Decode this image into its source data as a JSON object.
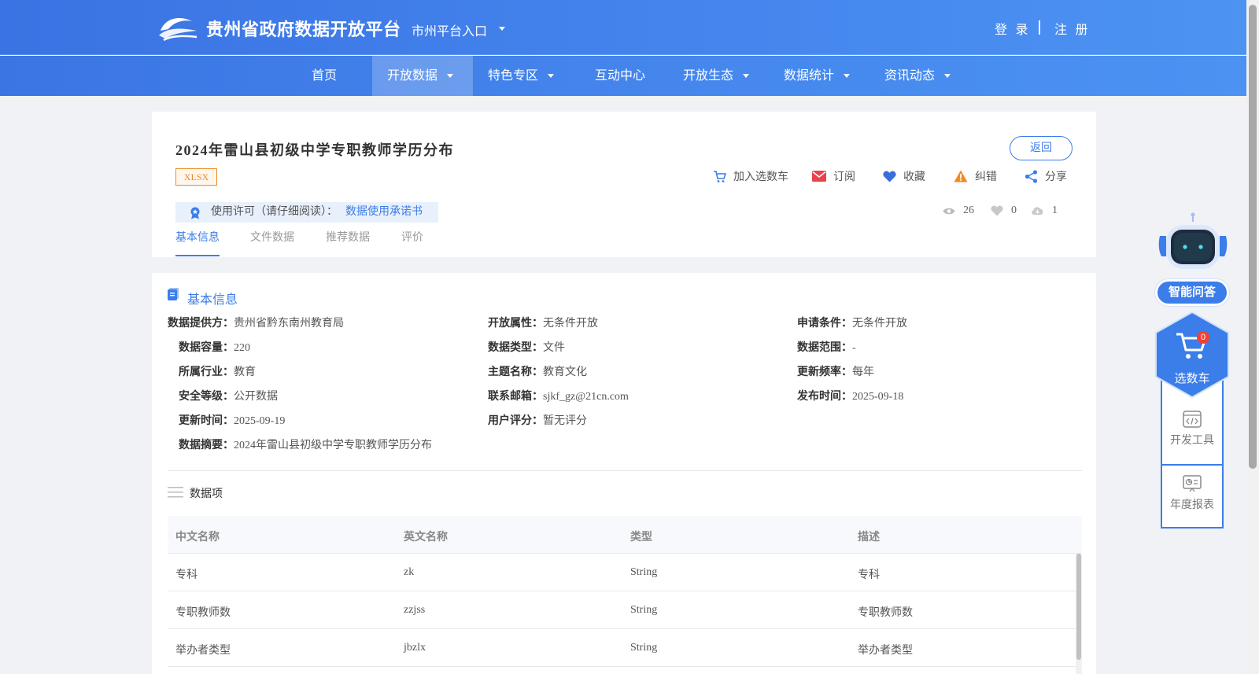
{
  "header": {
    "site_title": "贵州省政府数据开放平台",
    "city_entry": "市州平台入口",
    "login": "登 录",
    "register": "注 册"
  },
  "nav": {
    "items": [
      {
        "label": "首页"
      },
      {
        "label": "开放数据"
      },
      {
        "label": "特色专区"
      },
      {
        "label": "互动中心"
      },
      {
        "label": "开放生态"
      },
      {
        "label": "数据统计"
      },
      {
        "label": "资讯动态"
      }
    ],
    "active": "开放数据"
  },
  "dataset": {
    "title": "2024年雷山县初级中学专职教师学历分布",
    "format": "XLSX",
    "back": "返回",
    "actions": {
      "cart": "加入选数车",
      "subscribe": "订阅",
      "favorite": "收藏",
      "report": "纠错",
      "share": "分享"
    },
    "license_text": "使用许可（请仔细阅读）：",
    "license_link": "数据使用承诺书",
    "stats": {
      "views": "26",
      "likes": "0",
      "downloads": "1"
    },
    "tabs": [
      "基本信息",
      "文件数据",
      "推荐数据",
      "评价"
    ]
  },
  "basic_info": {
    "section_title": "基本信息",
    "fields": [
      {
        "label": "数据提供方：",
        "value": "贵州省黔东南州教育局"
      },
      {
        "label": "开放属性：",
        "value": "无条件开放"
      },
      {
        "label": "申请条件：",
        "value": "无条件开放"
      },
      {
        "label": "数据容量：",
        "value": "220"
      },
      {
        "label": "数据类型：",
        "value": "文件"
      },
      {
        "label": "数据范围：",
        "value": "-"
      },
      {
        "label": "所属行业：",
        "value": "教育"
      },
      {
        "label": "主题名称：",
        "value": "教育文化"
      },
      {
        "label": "更新频率：",
        "value": "每年"
      },
      {
        "label": "安全等级：",
        "value": "公开数据"
      },
      {
        "label": "联系邮箱：",
        "value": "sjkf_gz@21cn.com"
      },
      {
        "label": "发布时间：",
        "value": "2025-09-18"
      },
      {
        "label": "更新时间：",
        "value": "2025-09-19"
      },
      {
        "label": "用户评分：",
        "value": "暂无评分"
      },
      {
        "label": "数据摘要：",
        "value": "2024年雷山县初级中学专职教师学历分布"
      }
    ]
  },
  "data_items": {
    "title": "数据项",
    "columns": [
      "中文名称",
      "英文名称",
      "类型",
      "描述"
    ],
    "rows": [
      [
        "专科",
        "zk",
        "String",
        "专科"
      ],
      [
        "专职教师数",
        "zzjss",
        "String",
        "专职教师数"
      ],
      [
        "举办者类型",
        "jbzlx",
        "String",
        "举办者类型"
      ]
    ]
  },
  "sidebar": {
    "ai": "智能问答",
    "cart": "选数车",
    "cart_count": "0",
    "dev_tools": "开发工具",
    "annual_report": "年度报表"
  }
}
